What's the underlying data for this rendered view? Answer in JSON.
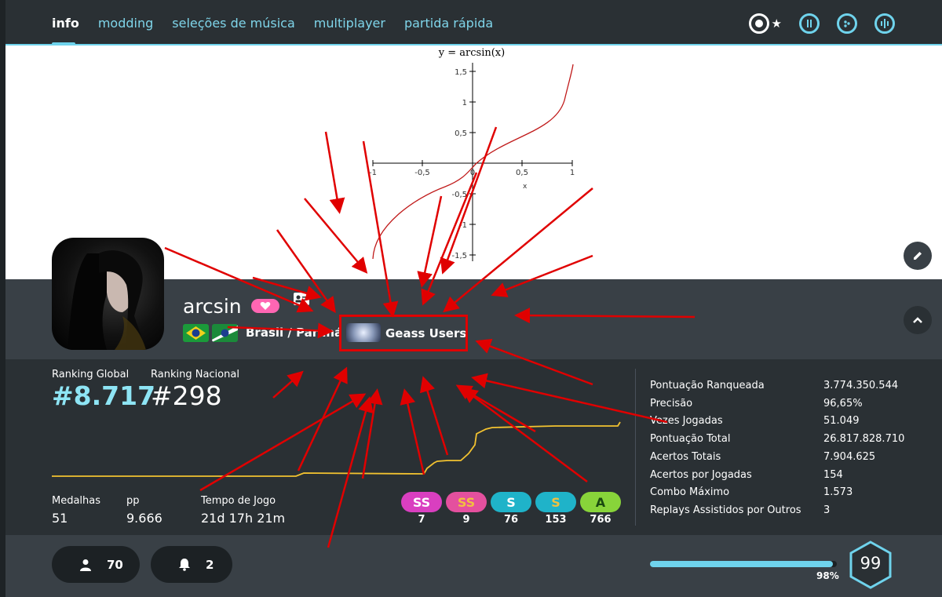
{
  "nav": {
    "tabs": [
      "info",
      "modding",
      "seleções de música",
      "multiplayer",
      "partida rápida"
    ],
    "active_tab": "info",
    "mode_icons": [
      "osu-standard-icon",
      "star-icon",
      "taiko-icon",
      "catch-icon",
      "mania-icon"
    ]
  },
  "cover_graph": {
    "title": "y = arcsin(x)",
    "x_ticks": [
      "-1",
      "-0,5",
      "0",
      "0,5",
      "1"
    ],
    "y_ticks": [
      "1,5",
      "1",
      "0,5",
      "-0,5",
      "-1",
      "-1,5"
    ],
    "x_label": "x"
  },
  "profile": {
    "username": "arcsin",
    "country": "Brasil / Paraná",
    "team": "Geass Users"
  },
  "ranking": {
    "global_label": "Ranking Global",
    "global_value": "#8.717",
    "national_label": "Ranking Nacional",
    "national_value": "#298"
  },
  "misc": {
    "medals_label": "Medalhas",
    "medals_value": "51",
    "pp_label": "pp",
    "pp_value": "9.666",
    "playtime_label": "Tempo de Jogo",
    "playtime_value": "21d 17h 21m"
  },
  "grades": [
    {
      "label": "SS",
      "count": "7",
      "bg": "#d93fc0",
      "fg": "#fff"
    },
    {
      "label": "SS",
      "count": "9",
      "bg": "#e4509e",
      "fg": "#f0c040"
    },
    {
      "label": "S",
      "count": "76",
      "bg": "#1fb3c9",
      "fg": "#fff"
    },
    {
      "label": "S",
      "count": "153",
      "bg": "#1fb3c9",
      "fg": "#f0c040"
    },
    {
      "label": "A",
      "count": "766",
      "bg": "#88d43a",
      "fg": "#1a4a10"
    }
  ],
  "stats": [
    {
      "key": "Pontuação Ranqueada",
      "value": "3.774.350.544"
    },
    {
      "key": "Precisão",
      "value": "96,65%"
    },
    {
      "key": "Vezes Jogadas",
      "value": "51.049"
    },
    {
      "key": "Pontuação Total",
      "value": "26.817.828.710"
    },
    {
      "key": "Acertos Totais",
      "value": "7.904.625"
    },
    {
      "key": "Acertos por Jogadas",
      "value": "154"
    },
    {
      "key": "Combo Máximo",
      "value": "1.573"
    },
    {
      "key": "Replays Assistidos por Outros",
      "value": "3"
    }
  ],
  "footer": {
    "friends": "70",
    "notifications": "2",
    "level_progress_label": "98%",
    "level_progress": 0.98,
    "level": "99"
  },
  "colors": {
    "accent": "#6fd3ec",
    "rank_global": "#8ee5f5",
    "history_line": "#f2c230",
    "annotation_red": "#e00000"
  }
}
